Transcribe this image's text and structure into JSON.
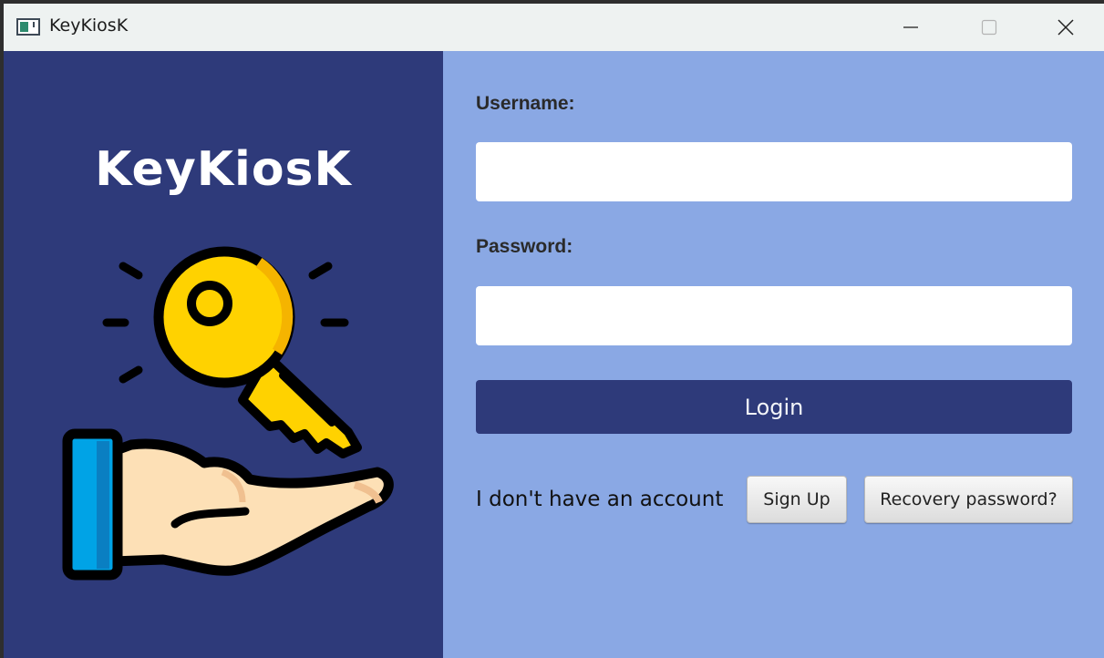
{
  "window": {
    "title": "KeyKiosK",
    "controls": {
      "minimize_icon": "minimize-icon",
      "maximize_icon": "maximize-icon",
      "close_icon": "close-icon"
    }
  },
  "branding": {
    "logo_text": "KeyKiosK",
    "illustration": "hand-holding-key-icon"
  },
  "form": {
    "username_label": "Username:",
    "username_value": "",
    "password_label": "Password:",
    "password_value": "",
    "login_label": "Login"
  },
  "footer": {
    "no_account_text": "I don't have an account",
    "signup_label": "Sign Up",
    "recovery_label": "Recovery password?"
  },
  "colors": {
    "left_panel": "#2e3a7a",
    "right_panel": "#8aa8e4",
    "login_button": "#2e3a7a",
    "key_yellow": "#ffd200",
    "sleeve_blue": "#00a3e6",
    "skin": "#fde0b6"
  }
}
